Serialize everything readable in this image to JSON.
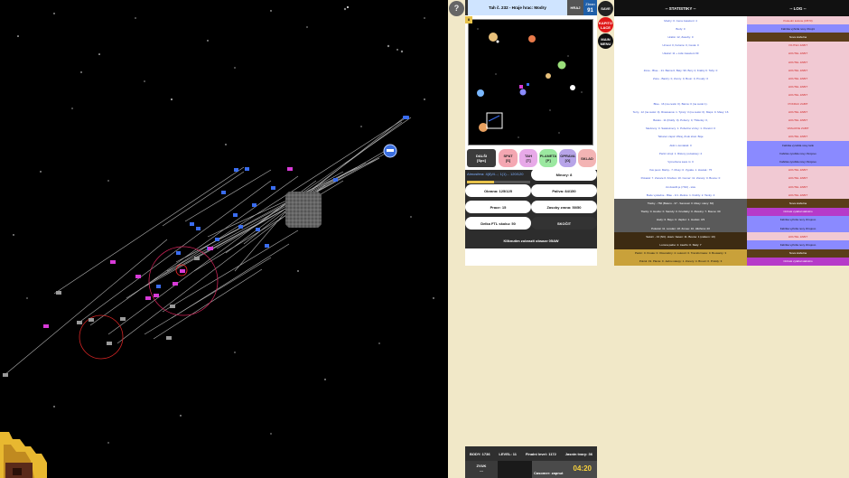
{
  "header": {
    "turn_info": "Tah č. 232 - Hraje hrac: Modry",
    "play_label": "HRAJ",
    "weapon_label": "Zbran",
    "weapon_value": "91"
  },
  "buttons": {
    "help": "?",
    "save": "SAVE",
    "kapito": "KAPITO LACE",
    "main_menu": "MAIN MENU"
  },
  "minimap": {
    "badge": "II"
  },
  "actions": {
    "dalsi": {
      "label": "DALŠI",
      "key": "[Spc]"
    },
    "spat": {
      "label": "SPAT",
      "key": "[S]"
    },
    "tah": {
      "label": "TAH",
      "key": "[T]"
    },
    "planeta": {
      "label": "PLANETA",
      "key": "[P]"
    },
    "oprava": {
      "label": "OPRAVA",
      "key": "[O]"
    },
    "sklad": {
      "label": "SKLAD",
      "key": ""
    }
  },
  "resources": {
    "text": "Atmosfera: 4(8)/4...; 1(1)... 120/120 "
  },
  "ship_stats": {
    "minory": "Minory: 8",
    "obrana": "Obrana: 125/125",
    "paliva": "Paliva: 84/150",
    "prace": "Prace: 15",
    "zasoby": "Zasoby zrana: 50/50",
    "delka": "Delka FTL skoku: 50",
    "skocit": "SKOČIT",
    "kliknutim": "Kliknutim zobrazit obsaze 05AW"
  },
  "bottom": {
    "body": "BODY: 1736",
    "level": "LEVEL: 11",
    "final_level": "Finalni level: 1172",
    "jump_count": "Jasnin tvary: 36",
    "zvuk_label": "ZVUK",
    "zvuk_value": "---",
    "timer_label": "Casomer: zapnut",
    "timer_value": "04:20"
  },
  "statistics": {
    "title": "-- STATISTIKY --",
    "rows": [
      {
        "text": "Modry: 0. Cena zasazeni: 4",
        "bg": "#ffffff",
        "color": "#3b55d6"
      },
      {
        "text": "Body: 0",
        "bg": "#ffffff",
        "color": "#3b55d6"
      },
      {
        "text": "Hrabě: 12, Zasoby: 0",
        "bg": "#ffffff",
        "color": "#3b55d6"
      },
      {
        "text": "Ucnesi: 0, Kolonie: 0, Cesta: 0",
        "bg": "#ffffff",
        "color": "#3b55d6"
      },
      {
        "text": "Ukazal: 11 + Lidé zasazeni 09",
        "bg": "#ffffff",
        "color": "#3b55d6"
      },
      {
        "text": "",
        "bg": "#ffffff",
        "color": "#3b55d6"
      },
      {
        "text": "Zone - Blue... 21. Barna 0, Baty: 99. Bory 4, Krabty 0. Tahy: 0",
        "bg": "#ffffff",
        "color": "#3b55d6"
      },
      {
        "text": "Zone - Bactry: 0, Zvony: 0, Boun: 0, Proudy: 0",
        "bg": "#ffffff",
        "color": "#3b55d6"
      },
      {
        "text": "",
        "bg": "#ffffff",
        "color": "#3b55d6"
      },
      {
        "text": "",
        "bg": "#ffffff",
        "color": "#3b55d6"
      },
      {
        "text": "Blue.. 16 (na cestě: 0). Barna: 0 (na cestě 1).",
        "bg": "#ffffff",
        "color": "#3b55d6"
      },
      {
        "text": "Terry.. 12 (na cestě: 0). Rrawsama: 1. Tyrely: 3 (na cestě: 0). Maps: 0. Masy: 16",
        "bg": "#ffffff",
        "color": "#3b55d6"
      },
      {
        "text": "Barelo.. 11 (Flotily: 0). Pobocy: 0, Třidenky: 0,",
        "bg": "#ffffff",
        "color": "#3b55d6"
      },
      {
        "text": "Sledovny: 0. Sateloimery: 1. Pobočné vrstvy: 1. Pocetní: 0",
        "bg": "#ffffff",
        "color": "#3b55d6"
      },
      {
        "text": "Tebaren zapol: Zbraj, Zvuk slost. Boje",
        "bg": "#ffffff",
        "color": "#3b55d6"
      },
      {
        "text": "Aktiv v kontaktě: 0",
        "bg": "#ffffff",
        "color": "#3b55d6"
      },
      {
        "text": "Partní stroji: 1. Ristory pozastavy: 4",
        "bg": "#ffffff",
        "color": "#3b55d6"
      },
      {
        "text": "Vymezlena sava m: 0",
        "bg": "#ffffff",
        "color": "#3b55d6"
      },
      {
        "text": "Vus pevo: Malny.. 7. Musy: 0. Vypala. 1. Houtak.: 75",
        "bg": "#ffffff",
        "color": "#3b55d6"
      },
      {
        "text": "Pokarat: 7. Zonare 0. Kriebus: 10. Cemer: 11. Zonary: 0. Boune: 0",
        "bg": "#ffffff",
        "color": "#3b55d6"
      },
      {
        "text": "Jsi dosáhl je (7/32) - stav",
        "bg": "#ffffff",
        "color": "#3b55d6"
      },
      {
        "text": "Bude vysledne - Blau - 1/1. Zletice: 1. Krabty: 2. Tanky: 4",
        "bg": "#ffffff",
        "color": "#3b55d6"
      },
      {
        "text": "Tlacky - 766 (Bateru - 37 - Sanovat: 0. Masy: stavy: 60)",
        "bg": "#5a5a5a",
        "color": "#ffffff"
      },
      {
        "text": "Tlacky: 0. Houbo: 0. Sarody: 0. Krudtaby: 0. Zlewtny: 7. Boune: 30",
        "bg": "#5a5a5a",
        "color": "#ffffff"
      },
      {
        "text": "Hody: 0. Bayo: 0. Vapitur: 1. Hodsio: 3/3",
        "bg": "#5a5a5a",
        "color": "#ffffff"
      },
      {
        "text": "Pokarat: 11. Lorelan: 18. Zonee: 10. Hikthora: 20",
        "bg": "#5a5a5a",
        "color": "#ffffff"
      },
      {
        "text": "Saturn - 13 (NC). stavu: basen: 11. Boune: 1 (celkem: 10)",
        "bg": "#3d2b12",
        "color": "#ffffff"
      },
      {
        "text": "Lorona palno: 2. zawrlo: 0. Slaty: 7",
        "bg": "#3d2b12",
        "color": "#ffffff"
      },
      {
        "text": "Pankl.: 0. Kruale: 0. Otsunafory: 4. Lukovci: 0. Transformace: 0. Bousanty: 3",
        "bg": "#c9a13a",
        "color": "#111111"
      },
      {
        "text": "Pokrol: 19. Plavte: 0. Jednu staspy: 1. Zonery: 4. Brouci: 0. Prolidy: 3",
        "bg": "#c9a13a",
        "color": "#111111"
      }
    ]
  },
  "log": {
    "title": "-- LOG --",
    "rows": [
      {
        "text": "Poslední kolonie (0/570)",
        "bg": "#f1c9d3",
        "color": "#d12a2a"
      },
      {
        "text": "Fabrika vyhnila novy zbrojní",
        "bg": "#8a8aff",
        "color": "#111111"
      },
      {
        "text": "Nova stabulna",
        "bg": "#5a3d1a",
        "color": "#ffffff"
      },
      {
        "text": "VOJTEC ZABIT",
        "bg": "#f1c9d3",
        "color": "#d12a2a"
      },
      {
        "text": "HOUTEL ZABIT",
        "bg": "#f1c9d3",
        "color": "#d12a2a"
      },
      {
        "text": "HOUTEL ZABIT",
        "bg": "#f1c9d3",
        "color": "#d12a2a"
      },
      {
        "text": "HOUTEL ZABIT",
        "bg": "#f1c9d3",
        "color": "#d12a2a"
      },
      {
        "text": "HOUTEL ZABIT",
        "bg": "#f1c9d3",
        "color": "#d12a2a"
      },
      {
        "text": "HOUTEL ZABIT",
        "bg": "#f1c9d3",
        "color": "#d12a2a"
      },
      {
        "text": "HOUTEL ZABIT",
        "bg": "#f1c9d3",
        "color": "#d12a2a"
      },
      {
        "text": "POKRAC ZABIT",
        "bg": "#f1c9d3",
        "color": "#d12a2a"
      },
      {
        "text": "HOUTEL ZABIT",
        "bg": "#f1c9d3",
        "color": "#d12a2a"
      },
      {
        "text": "HOUTEL ZABIT",
        "bg": "#f1c9d3",
        "color": "#d12a2a"
      },
      {
        "text": "VRAHOVE ZABIT",
        "bg": "#f1c9d3",
        "color": "#d12a2a"
      },
      {
        "text": "HOUTEL ZABIT",
        "bg": "#f1c9d3",
        "color": "#d12a2a"
      },
      {
        "text": "Fabrika vyrobila novy tank",
        "bg": "#8a8aff",
        "color": "#111111"
      },
      {
        "text": "Fabrika vyrobila novy zbrojovo",
        "bg": "#8a8aff",
        "color": "#111111"
      },
      {
        "text": "Fabrika vyrobila novy zbrojovo",
        "bg": "#8a8aff",
        "color": "#111111"
      },
      {
        "text": "HOUTEL ZABIT",
        "bg": "#f1c9d3",
        "color": "#d12a2a"
      },
      {
        "text": "HOUTEL ZABIT",
        "bg": "#f1c9d3",
        "color": "#d12a2a"
      },
      {
        "text": "HOUTEL ZABIT",
        "bg": "#f1c9d3",
        "color": "#d12a2a"
      },
      {
        "text": "HOUTEL ZABIT",
        "bg": "#f1c9d3",
        "color": "#d12a2a"
      },
      {
        "text": "Nova stabulna",
        "bg": "#5a3d1a",
        "color": "#ffffff"
      },
      {
        "text": "Cizinek vytahal stabulno",
        "bg": "#b63ac9",
        "color": "#ffffff"
      },
      {
        "text": "Fabrika vyhnila novy zbrojovo",
        "bg": "#8a8aff",
        "color": "#111111"
      },
      {
        "text": "Fabrika vyhnila novy zbrojovo",
        "bg": "#8a8aff",
        "color": "#111111"
      },
      {
        "text": "HOUTEL ZABIT",
        "bg": "#f1c9d3",
        "color": "#d12a2a"
      },
      {
        "text": "Fabrika vyhnila novy zbrojovo",
        "bg": "#8a8aff",
        "color": "#111111"
      },
      {
        "text": "Nova stabulna",
        "bg": "#5a3d1a",
        "color": "#ffffff"
      },
      {
        "text": "Cizinek vytahal stabulno",
        "bg": "#b63ac9",
        "color": "#ffffff"
      }
    ]
  }
}
